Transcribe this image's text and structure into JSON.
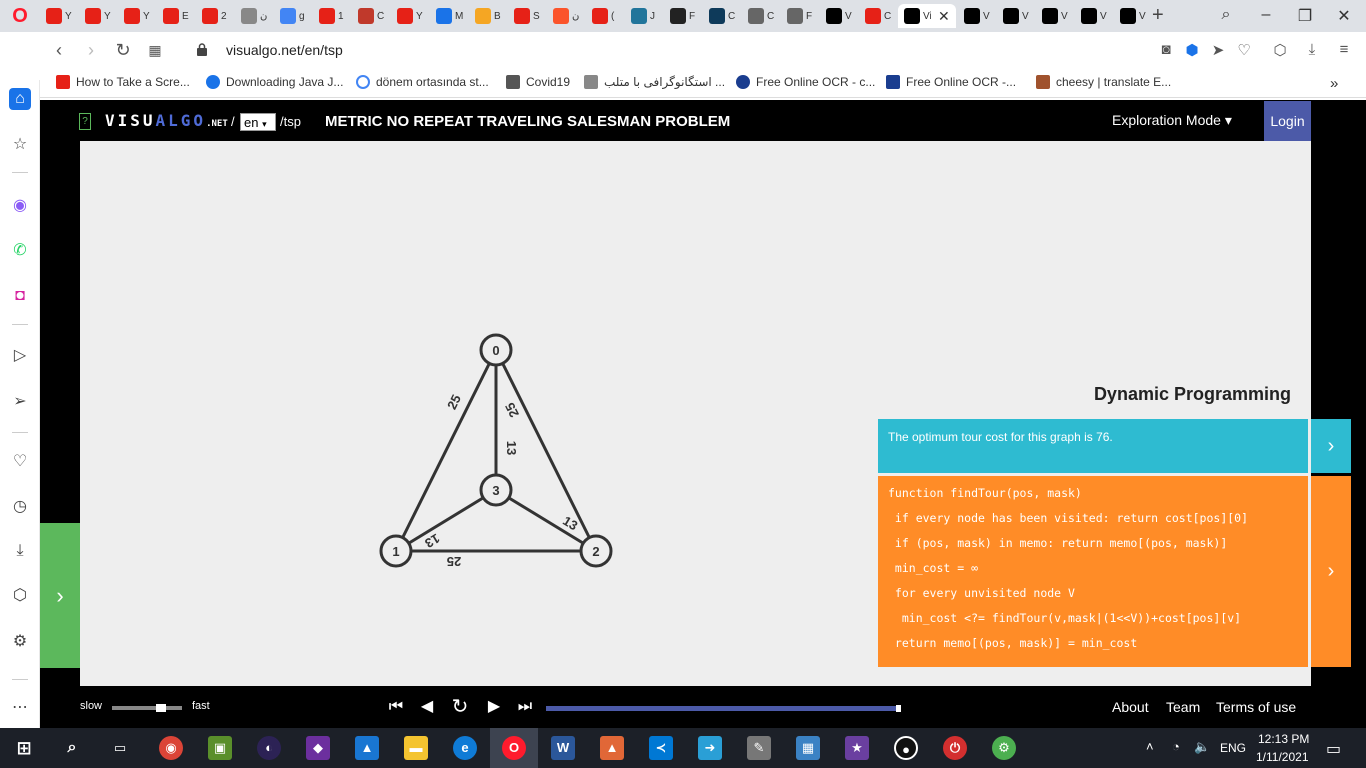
{
  "browser": {
    "tabs": [
      {
        "label": "Y",
        "color": "#e62117"
      },
      {
        "label": "Y",
        "color": "#e62117"
      },
      {
        "label": "Y",
        "color": "#e62117"
      },
      {
        "label": "E",
        "color": "#e62117"
      },
      {
        "label": "2",
        "color": "#e62117"
      },
      {
        "label": "ن",
        "color": "#888888"
      },
      {
        "label": "g",
        "color": "#4285f4"
      },
      {
        "label": "1",
        "color": "#e62117"
      },
      {
        "label": "Ĉ",
        "color": "#c0392b"
      },
      {
        "label": "Y",
        "color": "#e62117"
      },
      {
        "label": "M",
        "color": "#1a73e8"
      },
      {
        "label": "B",
        "color": "#f5a623"
      },
      {
        "label": "S",
        "color": "#e62117"
      },
      {
        "label": "ن",
        "color": "#fb542b"
      },
      {
        "label": "(",
        "color": "#e62117"
      },
      {
        "label": "J",
        "color": "#21759b"
      },
      {
        "label": "F",
        "color": "#222222"
      },
      {
        "label": "C",
        "color": "#0e3a5a"
      },
      {
        "label": "C",
        "color": "#666666"
      },
      {
        "label": "F",
        "color": "#666666"
      },
      {
        "label": "V",
        "color": "#000000"
      },
      {
        "label": "C",
        "color": "#e62117"
      },
      {
        "label": "Vi",
        "color": "#000000",
        "active": true
      },
      {
        "label": "V",
        "color": "#000000"
      },
      {
        "label": "V",
        "color": "#000000"
      },
      {
        "label": "V",
        "color": "#000000"
      },
      {
        "label": "V",
        "color": "#000000"
      },
      {
        "label": "V",
        "color": "#000000"
      }
    ],
    "new_tab": "+",
    "url": "visualgo.net/en/tsp",
    "bookmarks": [
      {
        "label": "How to Take a Scre...",
        "color": "#e62117"
      },
      {
        "label": "Downloading Java J...",
        "color": "#1a73e8"
      },
      {
        "label": "dönem ortasında st...",
        "color": "#4285f4"
      },
      {
        "label": "Covid19",
        "color": "#555555"
      },
      {
        "label": "استگانوگرافی با متلب ...",
        "color": "#888888"
      },
      {
        "label": "Free Online OCR - c...",
        "color": "#1a3d8f"
      },
      {
        "label": "Free Online OCR -...",
        "color": "#1a3d8f"
      },
      {
        "label": "cheesy | translate E...",
        "color": "#a0522d"
      }
    ],
    "bookmarks_more": "»"
  },
  "visualgo": {
    "help": "?",
    "logo_visu": "VISU",
    "logo_algo": "ALGO",
    "logo_net": ".NET",
    "slash": "/",
    "lang": "en",
    "path": "/tsp",
    "title": "METRIC NO REPEAT TRAVELING SALESMAN PROBLEM",
    "mode": "Exploration Mode ▾",
    "login": "Login",
    "algorithm": "Dynamic Programming",
    "status": "The optimum tour cost for this graph is 76.",
    "code": [
      "function findTour(pos, mask)",
      " if every node has been visited: return cost[pos][0]",
      " if (pos, mask) in memo: return memo[(pos, mask)]",
      " min_cost = ∞",
      " for every unvisited node V",
      "  min_cost <?= findTour(v,mask|(1<<V))+cost[pos][v]",
      " return memo[(pos, mask)] = min_cost"
    ],
    "graph": {
      "vertices": [
        "0",
        "1",
        "2",
        "3"
      ],
      "edges": [
        {
          "from": "0",
          "to": "1",
          "weight": "25"
        },
        {
          "from": "0",
          "to": "2",
          "weight": "25"
        },
        {
          "from": "0",
          "to": "3",
          "weight": "13"
        },
        {
          "from": "1",
          "to": "2",
          "weight": "25"
        },
        {
          "from": "1",
          "to": "3",
          "weight": "13"
        },
        {
          "from": "2",
          "to": "3",
          "weight": "13"
        }
      ]
    },
    "footer": {
      "slow": "slow",
      "fast": "fast",
      "speed": 0.7,
      "progress": 1.0,
      "about": "About",
      "team": "Team",
      "terms": "Terms of use"
    }
  },
  "taskbar": {
    "lang": "ENG",
    "time": "12:13 PM",
    "date": "1/11/2021"
  }
}
